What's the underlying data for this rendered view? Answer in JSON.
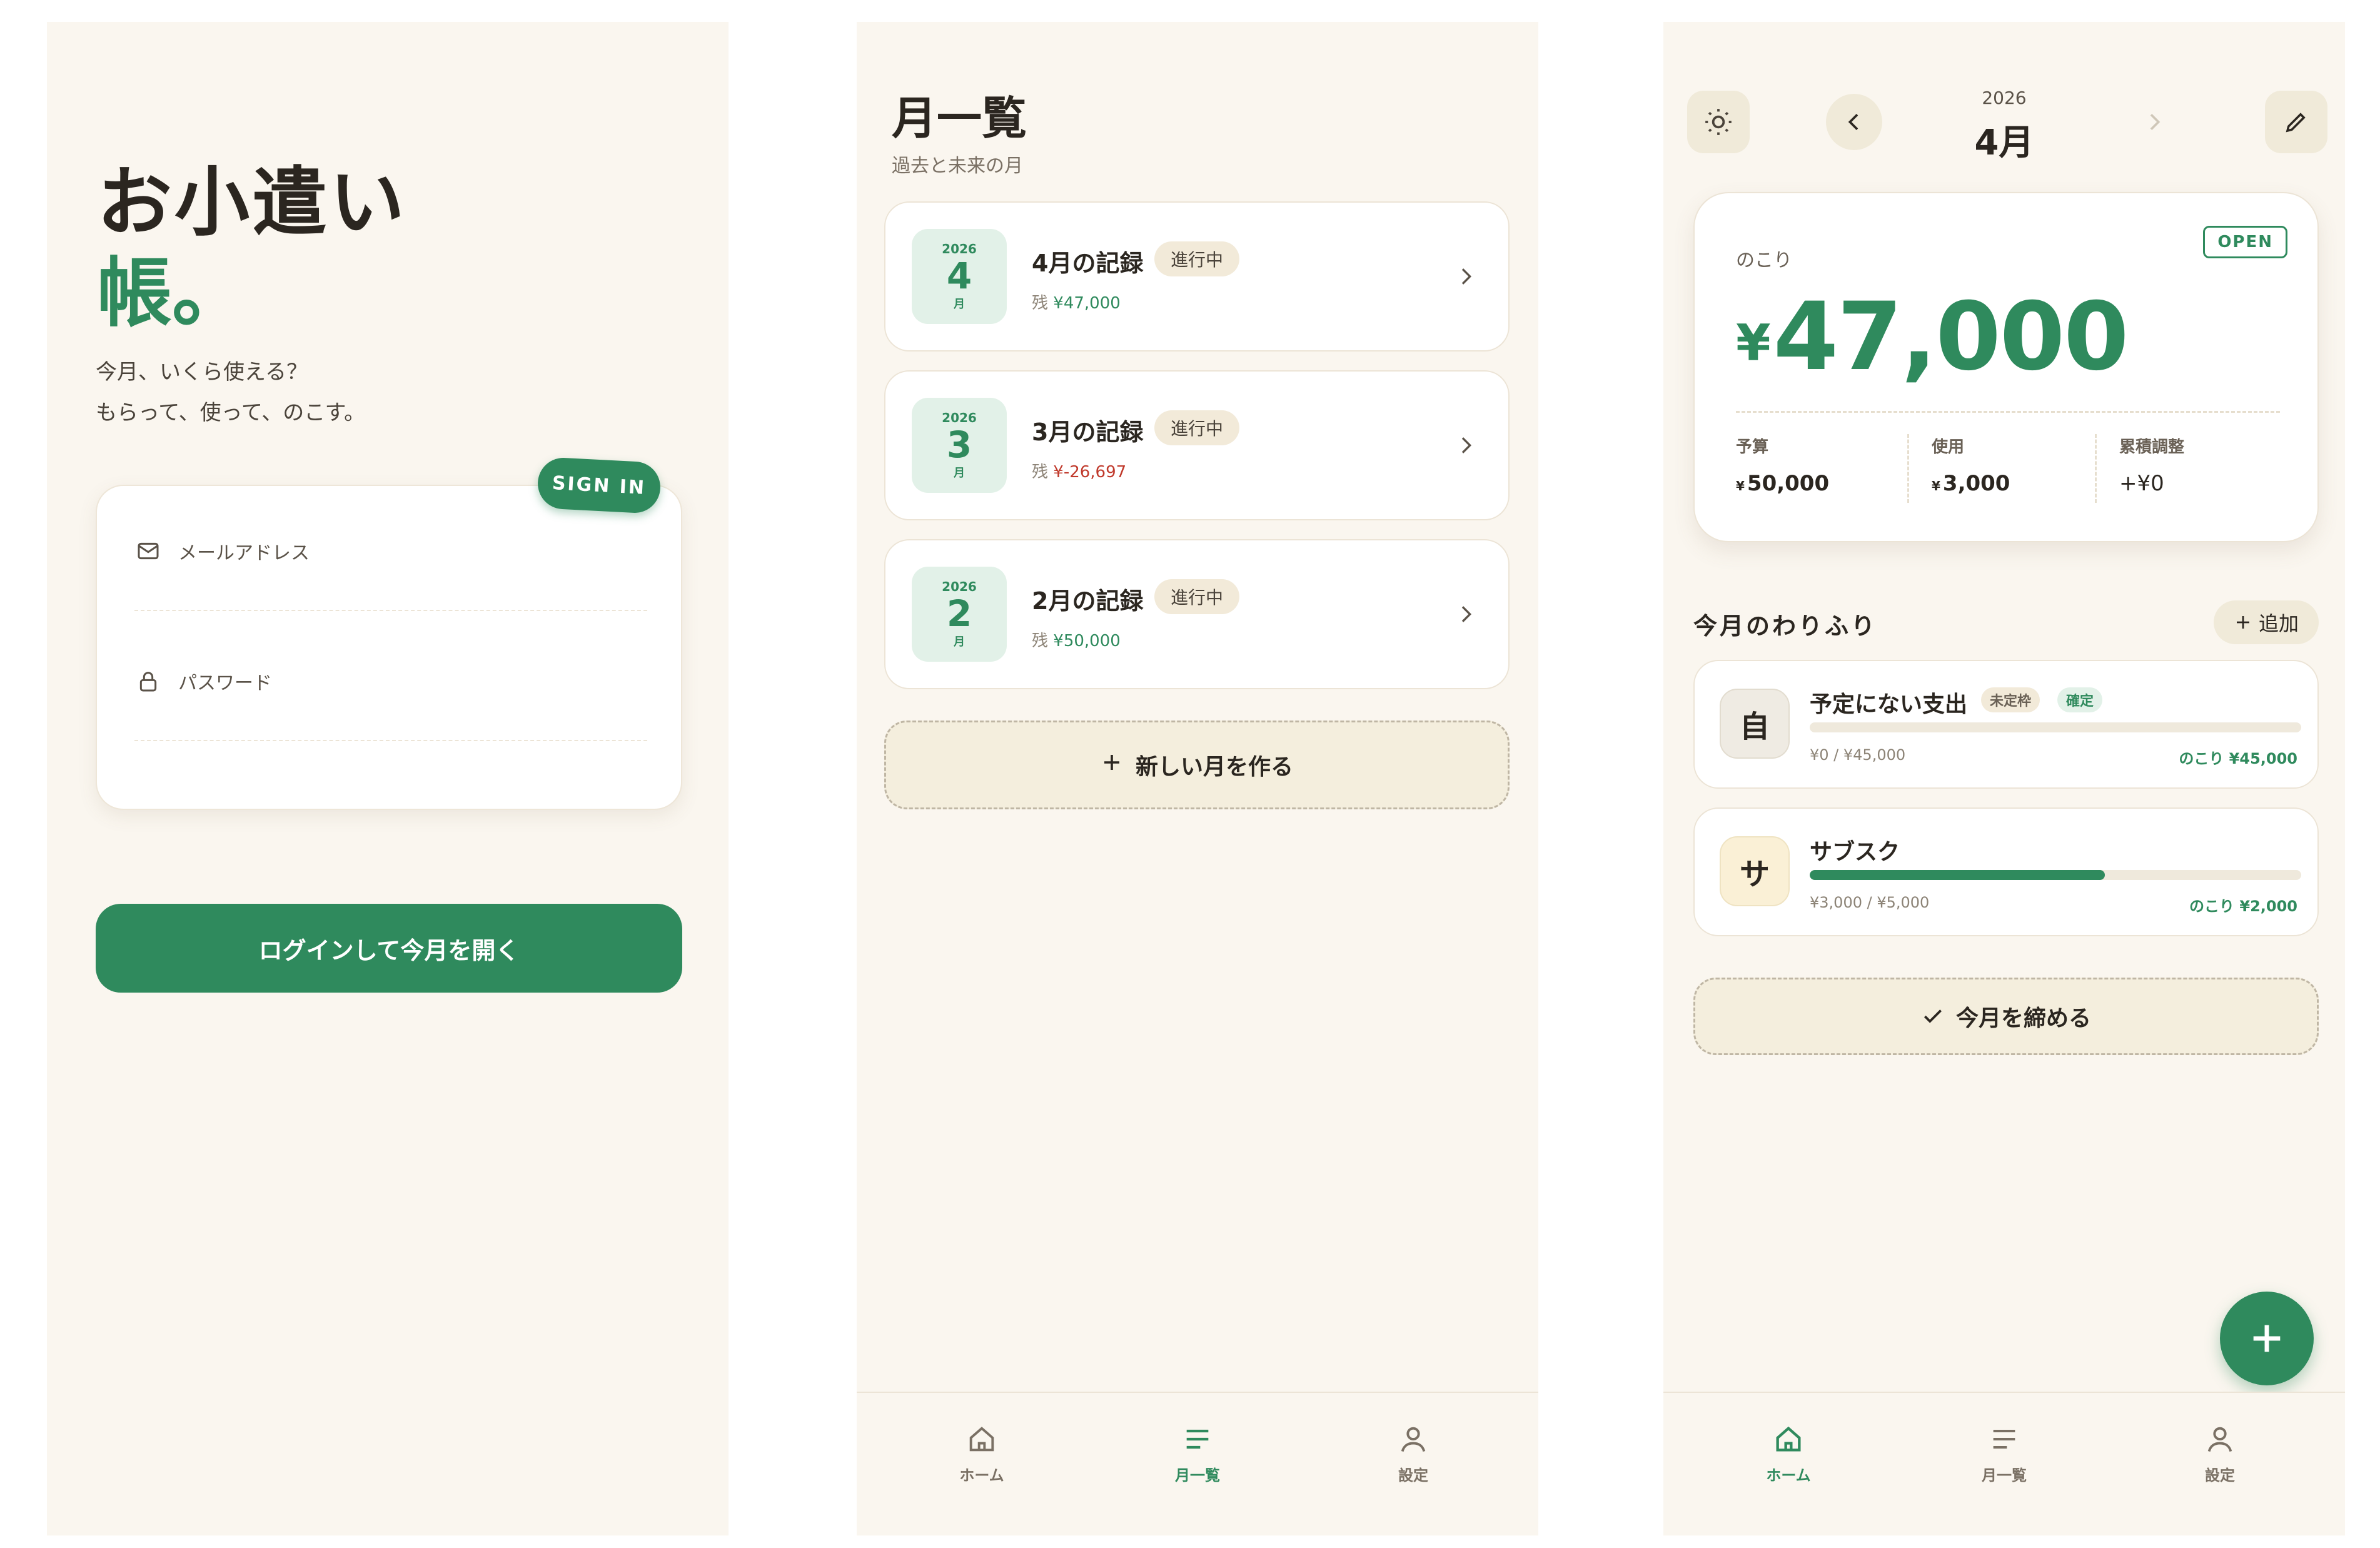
{
  "login": {
    "title": "お小遣い",
    "title_accent": "帳。",
    "tagline_1": "今月、いくら使える？",
    "tagline_2": "もらって、使って、のこす。",
    "signin_badge": "SIGN IN",
    "email_label": "メールアドレス",
    "password_label": "パスワード",
    "login_button": "ログインして今月を開く"
  },
  "month_list": {
    "title": "月一覧",
    "subtitle": "過去と未来の月",
    "months": [
      {
        "year": "2026",
        "month": "4",
        "unit": "月",
        "title": "4月の記録",
        "status": "進行中",
        "balance_prefix": "残",
        "balance": "¥47,000",
        "balance_color": "#2f8a5d"
      },
      {
        "year": "2026",
        "month": "3",
        "unit": "月",
        "title": "3月の記録",
        "status": "進行中",
        "balance_prefix": "残",
        "balance": "¥-26,697",
        "balance_color": "#c0392b"
      },
      {
        "year": "2026",
        "month": "2",
        "unit": "月",
        "title": "2月の記録",
        "status": "進行中",
        "balance_prefix": "残",
        "balance": "¥50,000",
        "balance_color": "#2f8a5d"
      }
    ],
    "new_month_button": "新しい月を作る"
  },
  "nav": {
    "home": "ホーム",
    "list": "月一覧",
    "settings": "設定"
  },
  "home": {
    "year": "2026",
    "month": "4月",
    "open_badge": "OPEN",
    "remaining_label": "のこり",
    "yen_symbol": "¥",
    "remaining_amount": "47,000",
    "stats": {
      "budget_label": "予算",
      "budget_value": "50,000",
      "used_label": "使用",
      "used_value": "3,000",
      "adjust_label": "累積調整",
      "adjust_value": "+¥0",
      "small_yen": "¥"
    },
    "section_title": "今月のわりふり",
    "add_button": "追加",
    "categories": [
      {
        "avatar": "自",
        "avatar_bg": "#efebe3",
        "name": "予定にない支出",
        "tag1": "未定枠",
        "tag2": "確定",
        "used": "¥0 / ¥45,000",
        "remaining": "のこり ¥45,000",
        "progress": 0.0
      },
      {
        "avatar": "サ",
        "avatar_bg": "#faf0d6",
        "name": "サブスク",
        "used": "¥3,000 / ¥5,000",
        "remaining": "のこり ¥2,000",
        "progress": 0.6
      }
    ],
    "close_month_button": "今月を締める"
  },
  "colors": {
    "accent": "#2f8a5d",
    "background": "#faf6ef",
    "negative": "#c0392b"
  }
}
